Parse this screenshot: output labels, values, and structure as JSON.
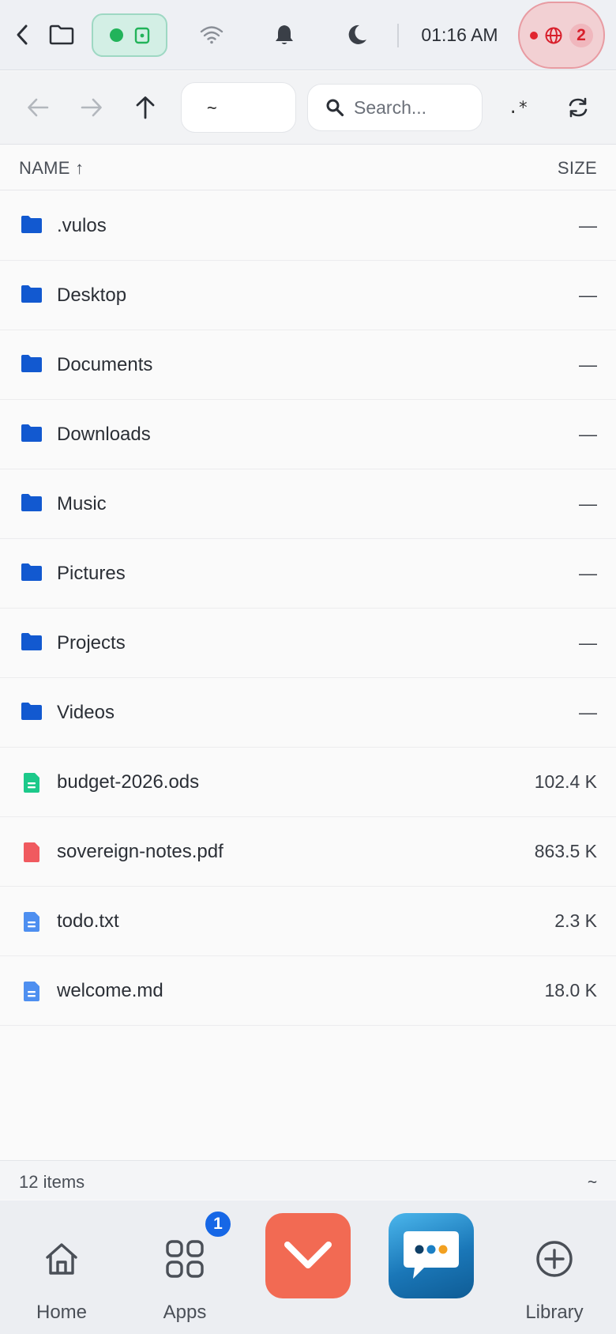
{
  "status_bar": {
    "time": "01:16 AM",
    "alert_count": "2"
  },
  "toolbar": {
    "path": "~",
    "search_placeholder": "Search...",
    "regex_label": ".*"
  },
  "list_header": {
    "name_label": "NAME ↑",
    "size_label": "SIZE"
  },
  "files": [
    {
      "name": ".vulos",
      "size": "—",
      "kind": "folder"
    },
    {
      "name": "Desktop",
      "size": "—",
      "kind": "folder"
    },
    {
      "name": "Documents",
      "size": "—",
      "kind": "folder"
    },
    {
      "name": "Downloads",
      "size": "—",
      "kind": "folder"
    },
    {
      "name": "Music",
      "size": "—",
      "kind": "folder"
    },
    {
      "name": "Pictures",
      "size": "—",
      "kind": "folder"
    },
    {
      "name": "Projects",
      "size": "—",
      "kind": "folder"
    },
    {
      "name": "Videos",
      "size": "—",
      "kind": "folder"
    },
    {
      "name": "budget-2026.ods",
      "size": "102.4 K",
      "kind": "spreadsheet"
    },
    {
      "name": "sovereign-notes.pdf",
      "size": "863.5 K",
      "kind": "pdf"
    },
    {
      "name": "todo.txt",
      "size": "2.3 K",
      "kind": "text"
    },
    {
      "name": "welcome.md",
      "size": "18.0 K",
      "kind": "text"
    }
  ],
  "footer": {
    "item_count": "12 items",
    "path": "~"
  },
  "dock": {
    "home_label": "Home",
    "apps_label": "Apps",
    "apps_badge": "1",
    "library_label": "Library"
  },
  "colors": {
    "folder": "#1259d0",
    "spreadsheet": "#1cc98a",
    "pdf": "#f05a5f",
    "text": "#4e8ff0",
    "accent": "#1667e6"
  }
}
